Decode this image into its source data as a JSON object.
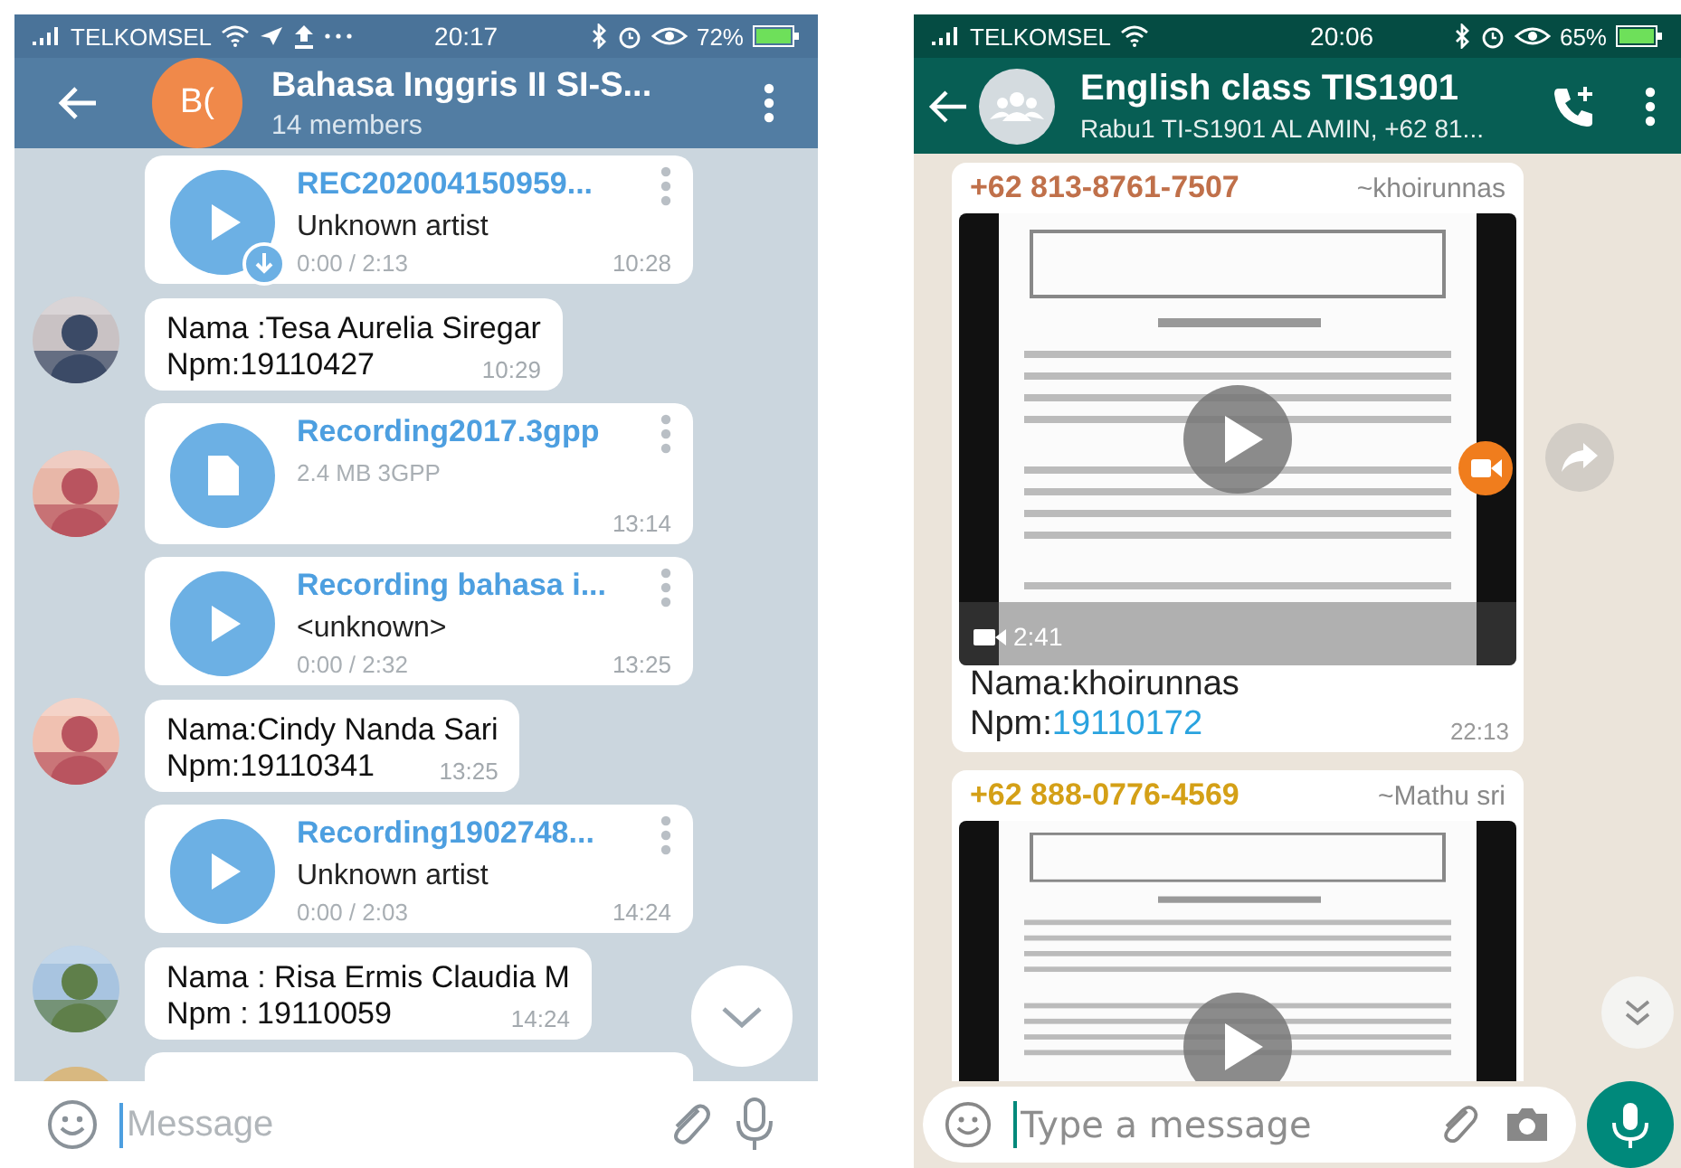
{
  "left_phone": {
    "status_bar": {
      "carrier": "TELKOMSEL",
      "time": "20:17",
      "battery": "72%"
    },
    "header": {
      "avatar_initials": "B(",
      "title": "Bahasa Inggris II SI-S...",
      "subtitle": "14 members"
    },
    "messages": [
      {
        "kind": "audio",
        "avatar": false,
        "downloading": true,
        "title": "REC202004150959...",
        "artist": "Unknown artist",
        "progress": "0:00 / 2:13",
        "time": "10:28"
      },
      {
        "kind": "text",
        "avatar": true,
        "lines": [
          "Nama :Tesa Aurelia Siregar",
          "Npm:19110427"
        ],
        "time": "10:29"
      },
      {
        "kind": "file",
        "avatar": true,
        "title": "Recording2017.3gpp",
        "size": "2.4 MB 3GPP",
        "time": "13:14"
      },
      {
        "kind": "audio",
        "avatar": false,
        "downloading": false,
        "title": "Recording bahasa i...",
        "artist": "<unknown>",
        "progress": "0:00 / 2:32",
        "time": "13:25"
      },
      {
        "kind": "text",
        "avatar": true,
        "lines": [
          "Nama:Cindy Nanda Sari",
          "Npm:19110341"
        ],
        "time": "13:25"
      },
      {
        "kind": "audio",
        "avatar": false,
        "downloading": false,
        "title": "Recording1902748...",
        "artist": "Unknown artist",
        "progress": "0:00 / 2:03",
        "time": "14:24"
      },
      {
        "kind": "text",
        "avatar": true,
        "lines": [
          "Nama : Risa Ermis Claudia M",
          "Npm : 19110059"
        ],
        "time": "14:24"
      },
      {
        "kind": "partial",
        "avatar": true
      }
    ],
    "composer": {
      "placeholder": "Message"
    }
  },
  "right_phone": {
    "status_bar": {
      "carrier": "TELKOMSEL",
      "time": "20:06",
      "battery": "65%"
    },
    "header": {
      "title": "English class TIS1901",
      "subtitle": "Rabu1 TI-S1901 AL AMIN, +62 81..."
    },
    "messages": [
      {
        "kind": "video",
        "sender_phone": "+62 813-8761-7507",
        "sender_name": "~khoirunnas",
        "color": "#c0704a",
        "duration": "2:41",
        "caption": "Nama:khoirunnas",
        "npm_label": "Npm:",
        "npm_link": "19110172",
        "time": "22:13"
      },
      {
        "kind": "video_cut",
        "sender_phone": "+62 888-0776-4569",
        "sender_name": "~Mathu sri",
        "color": "#d4a017"
      }
    ],
    "composer": {
      "placeholder": "Type a message"
    }
  }
}
